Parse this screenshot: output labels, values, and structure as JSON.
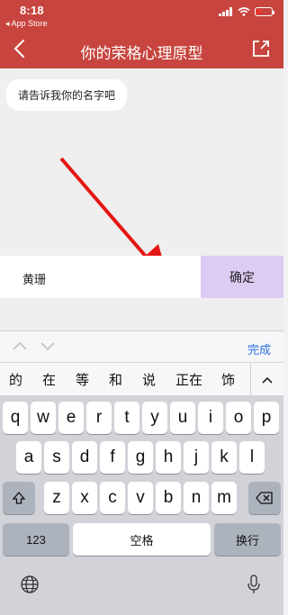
{
  "status": {
    "time": "8:18",
    "back_to": "◂ App Store"
  },
  "nav": {
    "title": "你的荣格心理原型"
  },
  "chat": {
    "message": "请告诉我你的名字吧"
  },
  "input": {
    "value": "黄珊",
    "confirm": "确定"
  },
  "toolbar": {
    "done": "完成"
  },
  "candidates": [
    "的",
    "在",
    "等",
    "和",
    "说",
    "正在",
    "饰"
  ],
  "keys": {
    "row1": [
      "q",
      "w",
      "e",
      "r",
      "t",
      "y",
      "u",
      "i",
      "o",
      "p"
    ],
    "row2": [
      "a",
      "s",
      "d",
      "f",
      "g",
      "h",
      "j",
      "k",
      "l"
    ],
    "row3": [
      "z",
      "x",
      "c",
      "v",
      "b",
      "n",
      "m"
    ],
    "num": "123",
    "space": "空格",
    "return": "换行"
  },
  "colors": {
    "nav": "#c7453e",
    "confirm_bg": "#dccbf3",
    "done": "#2f6fe0"
  }
}
